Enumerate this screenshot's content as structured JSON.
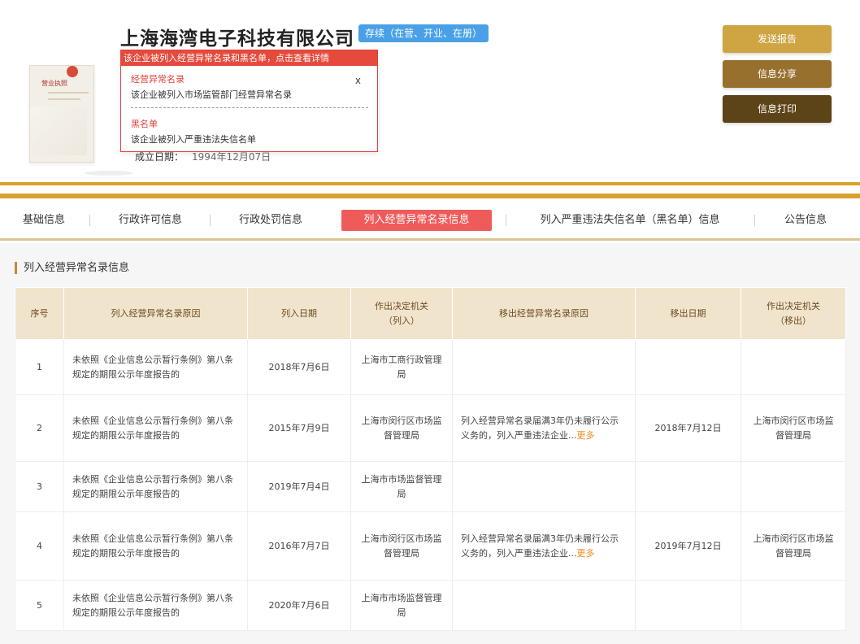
{
  "header": {
    "company_name": "上海海湾电子科技有限公司",
    "status_badge": "存续（在营、开业、在册）",
    "license_title": "营业执照",
    "established_label": "成立日期：",
    "established_value": "1994年12月07日"
  },
  "alert": {
    "banner": "该企业被列入经营异常名录和黑名单，点击查看详情",
    "close": "x",
    "section1_title": "经营异常名录",
    "section1_text": "该企业被列入市场监管部门经营异常名录",
    "section2_title": "黑名单",
    "section2_text": "该企业被列入严重违法失信名单"
  },
  "actions": {
    "report": "发送报告",
    "share": "信息分享",
    "print": "信息打印"
  },
  "tabs": [
    {
      "label": "基础信息",
      "active": false
    },
    {
      "label": "行政许可信息",
      "active": false
    },
    {
      "label": "行政处罚信息",
      "active": false
    },
    {
      "label": "列入经营异常名录信息",
      "active": true
    },
    {
      "label": "列入严重违法失信名单（黑名单）信息",
      "active": false
    },
    {
      "label": "公告信息",
      "active": false
    }
  ],
  "section_title": "列入经营异常名录信息",
  "table": {
    "headers": {
      "seq": "序号",
      "reason": "列入经营异常名录原因",
      "date_in": "列入日期",
      "authority_in_1": "作出决定机关",
      "authority_in_2": "（列入）",
      "remove_reason": "移出经营异常名录原因",
      "date_out": "移出日期",
      "authority_out_1": "作出决定机关",
      "authority_out_2": "（移出）"
    },
    "more_label": "更多",
    "rows": [
      {
        "seq": "1",
        "reason": "未依照《企业信息公示暂行条例》第八条规定的期限公示年度报告的",
        "date_in": "2018年7月6日",
        "authority_in": "上海市工商行政管理局",
        "remove_reason": "",
        "date_out": "",
        "authority_out": ""
      },
      {
        "seq": "2",
        "reason": "未依照《企业信息公示暂行条例》第八条规定的期限公示年度报告的",
        "date_in": "2015年7月9日",
        "authority_in": "上海市闵行区市场监督管理局",
        "remove_reason": "列入经营异常名录届满3年仍未履行公示义务的，列入严重违法企业...",
        "date_out": "2018年7月12日",
        "authority_out": "上海市闵行区市场监督管理局"
      },
      {
        "seq": "3",
        "reason": "未依照《企业信息公示暂行条例》第八条规定的期限公示年度报告的",
        "date_in": "2019年7月4日",
        "authority_in": "上海市市场监督管理局",
        "remove_reason": "",
        "date_out": "",
        "authority_out": ""
      },
      {
        "seq": "4",
        "reason": "未依照《企业信息公示暂行条例》第八条规定的期限公示年度报告的",
        "date_in": "2016年7月7日",
        "authority_in": "上海市闵行区市场监督管理局",
        "remove_reason": "列入经营异常名录届满3年仍未履行公示义务的，列入严重违法企业...",
        "date_out": "2019年7月12日",
        "authority_out": "上海市闵行区市场监督管理局"
      },
      {
        "seq": "5",
        "reason": "未依照《企业信息公示暂行条例》第八条规定的期限公示年度报告的",
        "date_in": "2020年7月6日",
        "authority_in": "上海市市场监督管理局",
        "remove_reason": "",
        "date_out": "",
        "authority_out": ""
      }
    ]
  },
  "colors": {
    "gold": "#d8a12e",
    "active_tab": "#ef5b5a",
    "alert_red": "#e54a3c",
    "status_blue": "#4aa0e6",
    "more_orange": "#f08a24",
    "table_header": "#f1e4cd"
  }
}
